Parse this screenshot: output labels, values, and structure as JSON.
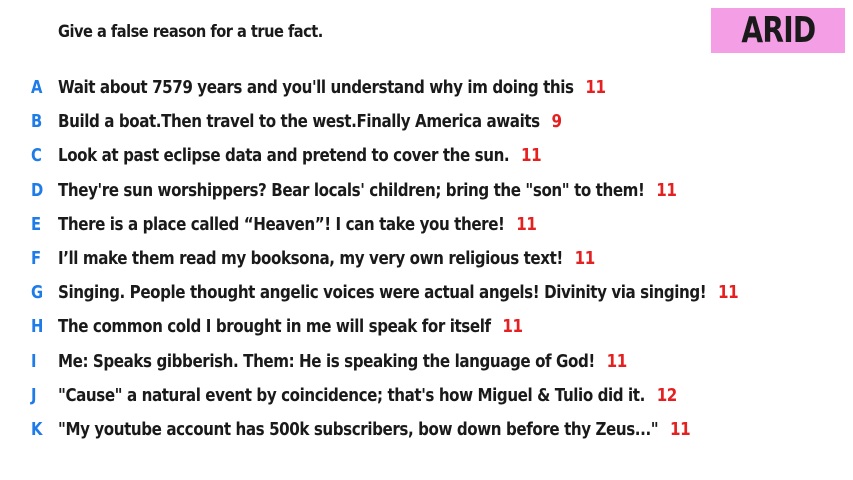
{
  "prompt": "Give a false reason for a true fact.",
  "badge": {
    "label": "ARID",
    "color": "#f49ee6"
  },
  "colors": {
    "letter": "#1e7be8",
    "score": "#e52020",
    "text": "#1a1a1a"
  },
  "answers": [
    {
      "letter": "A",
      "text": "Wait about 7579 years and you'll understand why im doing this",
      "score": "11"
    },
    {
      "letter": "B",
      "text": "Build a boat.Then travel to the west.Finally America awaits",
      "score": "9"
    },
    {
      "letter": "C",
      "text": "Look at past eclipse data and pretend to cover the sun.",
      "score": "11"
    },
    {
      "letter": "D",
      "text": "They're sun worshippers? Bear locals' children; bring the \"son\" to them!",
      "score": "11"
    },
    {
      "letter": "E",
      "text": "There is a place called “Heaven”! I can take you there!",
      "score": "11"
    },
    {
      "letter": "F",
      "text": "I’ll make them read my booksona, my very own religious text!",
      "score": "11"
    },
    {
      "letter": "G",
      "text": "Singing. People thought angelic voices were actual angels! Divinity via singing!",
      "score": "11"
    },
    {
      "letter": "H",
      "text": "The common cold I brought in me will speak for itself",
      "score": "11"
    },
    {
      "letter": "I",
      "text": "Me: Speaks gibberish. Them: He is speaking the language of God!",
      "score": "11"
    },
    {
      "letter": "J",
      "text": "\"Cause\" a natural event by coincidence; that's how Miguel & Tulio did it.",
      "score": "12"
    },
    {
      "letter": "K",
      "text": "\"My youtube account has 500k subscribers, bow down before thy Zeus...\"",
      "score": "11"
    }
  ]
}
